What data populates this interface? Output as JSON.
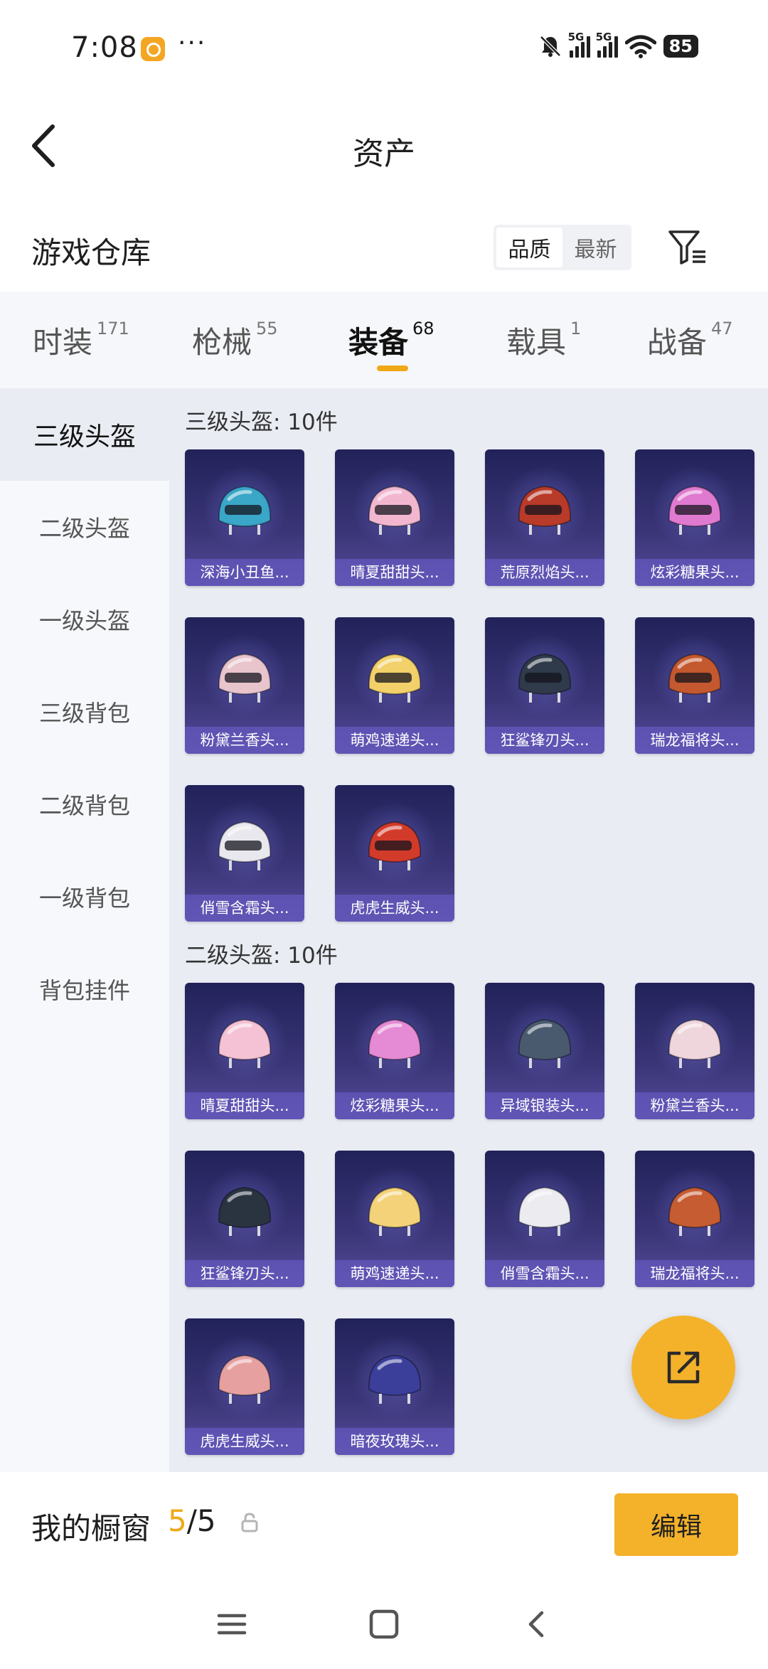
{
  "status_bar": {
    "time": "7:08",
    "dots": "···",
    "network_tag_1": "5G",
    "network_tag_2": "5G",
    "battery": "85"
  },
  "header": {
    "title": "资产"
  },
  "warehouse": {
    "title": "游戏仓库",
    "sort_options": [
      {
        "label": "品质",
        "active": true
      },
      {
        "label": "最新",
        "active": false
      }
    ]
  },
  "tabs": [
    {
      "label": "时装",
      "count": "171",
      "active": false
    },
    {
      "label": "枪械",
      "count": "55",
      "active": false
    },
    {
      "label": "装备",
      "count": "68",
      "active": true
    },
    {
      "label": "载具",
      "count": "1",
      "active": false
    },
    {
      "label": "战备",
      "count": "47",
      "active": false
    }
  ],
  "sidebar": {
    "items": [
      {
        "label": "三级头盔",
        "active": true
      },
      {
        "label": "二级头盔",
        "active": false
      },
      {
        "label": "一级头盔",
        "active": false
      },
      {
        "label": "三级背包",
        "active": false
      },
      {
        "label": "二级背包",
        "active": false
      },
      {
        "label": "一级背包",
        "active": false
      },
      {
        "label": "背包挂件",
        "active": false
      }
    ]
  },
  "sections": [
    {
      "title": "三级头盔: 10件",
      "items": [
        {
          "name": "深海小丑鱼...",
          "color": "#3aa6c8"
        },
        {
          "name": "晴夏甜甜头...",
          "color": "#f2b7cf"
        },
        {
          "name": "荒原烈焰头...",
          "color": "#b83a28"
        },
        {
          "name": "炫彩糖果头...",
          "color": "#e07ad0"
        },
        {
          "name": "粉黛兰香头...",
          "color": "#e8c4cc"
        },
        {
          "name": "萌鸡速递头...",
          "color": "#f2d06a"
        },
        {
          "name": "狂鲨锋刃头...",
          "color": "#2f3a4a"
        },
        {
          "name": "瑞龙福将头...",
          "color": "#c4582e"
        },
        {
          "name": "俏雪含霜头...",
          "color": "#e8e8ee"
        },
        {
          "name": "虎虎生威头...",
          "color": "#d23b2a"
        }
      ]
    },
    {
      "title": "二级头盔: 10件",
      "items": [
        {
          "name": "晴夏甜甜头...",
          "color": "#f4c2d4"
        },
        {
          "name": "炫彩糖果头...",
          "color": "#e58ad4"
        },
        {
          "name": "异域银装头...",
          "color": "#4a5a6e"
        },
        {
          "name": "粉黛兰香头...",
          "color": "#efd6dc"
        },
        {
          "name": "狂鲨锋刃头...",
          "color": "#2a3440"
        },
        {
          "name": "萌鸡速递头...",
          "color": "#f3d27a"
        },
        {
          "name": "俏雪含霜头...",
          "color": "#ececf0"
        },
        {
          "name": "瑞龙福将头...",
          "color": "#c65c32"
        },
        {
          "name": "虎虎生威头...",
          "color": "#e6a0a0"
        },
        {
          "name": "暗夜玫瑰头...",
          "color": "#3b3f9a"
        }
      ]
    }
  ],
  "bottom_bar": {
    "label": "我的橱窗",
    "current": "5",
    "total": "/5",
    "edit_label": "编辑"
  },
  "colors": {
    "accent": "#f4b22a",
    "card_top": "#22225a",
    "card_bottom": "#564c9c",
    "content_bg": "#e9ecf3"
  }
}
